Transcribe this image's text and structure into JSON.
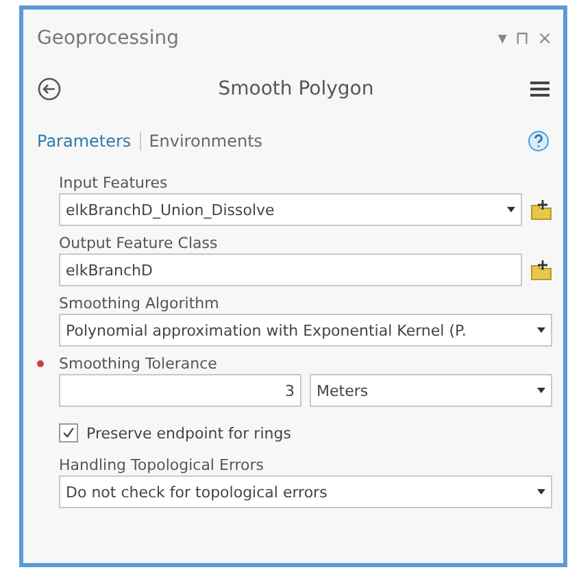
{
  "pane": {
    "title": "Geoprocessing",
    "controls": [
      "▾",
      "⊓",
      "×"
    ]
  },
  "tool": {
    "title": "Smooth Polygon"
  },
  "tabs": [
    {
      "label": "Parameters",
      "selected": true
    },
    {
      "label": "Environments",
      "selected": false
    }
  ],
  "parameters": [
    {
      "kind": "dropdown",
      "label": "Input Features",
      "required": false,
      "value": "elkBranchD_Union_Dissolve",
      "browse": true
    },
    {
      "kind": "text",
      "label": "Output Feature Class",
      "required": false,
      "value": "elkBranchD",
      "browse": true
    },
    {
      "kind": "dropdown",
      "label": "Smoothing Algorithm",
      "required": false,
      "value": "Polynomial approximation with Exponential Kernel (P.",
      "browse": false
    },
    {
      "kind": "linear",
      "label": "Smoothing Tolerance",
      "required": true,
      "value": "3",
      "unit": "Meters"
    },
    {
      "kind": "checkbox",
      "label": "Preserve endpoint for rings",
      "checked": true
    },
    {
      "kind": "dropdown",
      "label": "Handling Topological Errors",
      "required": false,
      "value": "Do not check for topological errors",
      "browse": false
    }
  ]
}
